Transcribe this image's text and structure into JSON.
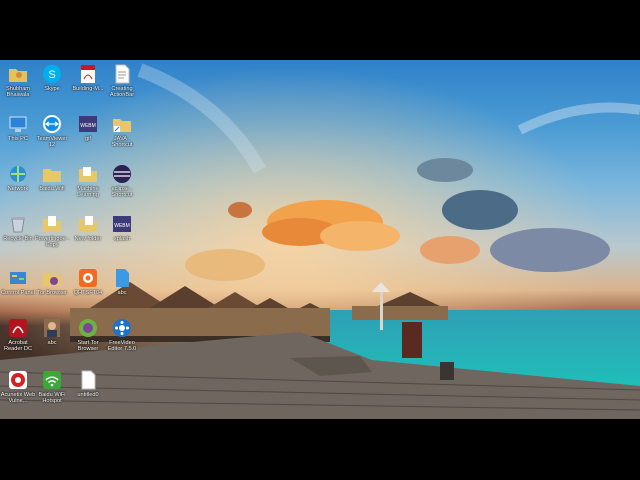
{
  "desktop": {
    "icons": [
      {
        "label": "Shubham Bhaiwala",
        "icon": "folder-user-icon"
      },
      {
        "label": "Skype",
        "icon": "skype-icon"
      },
      {
        "label": "Building-M...",
        "icon": "pdf-icon"
      },
      {
        "label": "Creating ActionBar",
        "icon": "document-icon"
      },
      {
        "label": "This PC",
        "icon": "computer-icon"
      },
      {
        "label": "TeamViewer 12",
        "icon": "teamviewer-icon"
      },
      {
        "label": "gif",
        "icon": "webm-icon"
      },
      {
        "label": "JAVA - Shortcut",
        "icon": "folder-shortcut-icon"
      },
      {
        "label": "Network",
        "icon": "network-icon"
      },
      {
        "label": "Baidu Wifi",
        "icon": "folder-icon"
      },
      {
        "label": "Machine Learning",
        "icon": "folder-icon"
      },
      {
        "label": "eclipse - Shortcut",
        "icon": "eclipse-icon"
      },
      {
        "label": "Recycle Bin",
        "icon": "recycle-bin-icon"
      },
      {
        "label": "Powerlingoe - Copy",
        "icon": "folder-icon"
      },
      {
        "label": "New folder",
        "icon": "folder-icon"
      },
      {
        "label": "splash",
        "icon": "webm-icon"
      },
      {
        "label": "Control Panel",
        "icon": "control-panel-icon"
      },
      {
        "label": "Tor Browser",
        "icon": "tor-browser-icon"
      },
      {
        "label": "QHTSFT04",
        "icon": "qht-icon"
      },
      {
        "label": "abc",
        "icon": "blue-file-icon"
      },
      {
        "label": "Acrobat Reader DC",
        "icon": "acrobat-icon"
      },
      {
        "label": "abc",
        "icon": "photo-icon"
      },
      {
        "label": "Start Tor Browser",
        "icon": "tor-start-icon"
      },
      {
        "label": "FreeVideo Editor 7.5.0",
        "icon": "video-editor-icon"
      },
      {
        "label": "Acunetix Web Vulne...",
        "icon": "acunetix-icon"
      },
      {
        "label": "Baidu WiFi Hotspot",
        "icon": "wifi-icon"
      },
      {
        "label": "untitled0",
        "icon": "blank-file-icon"
      }
    ],
    "colors": {
      "sky": "#2f82c9",
      "sea": "#27b3b8",
      "cloud": "#f2a24a",
      "deck": "#6e665f"
    }
  }
}
